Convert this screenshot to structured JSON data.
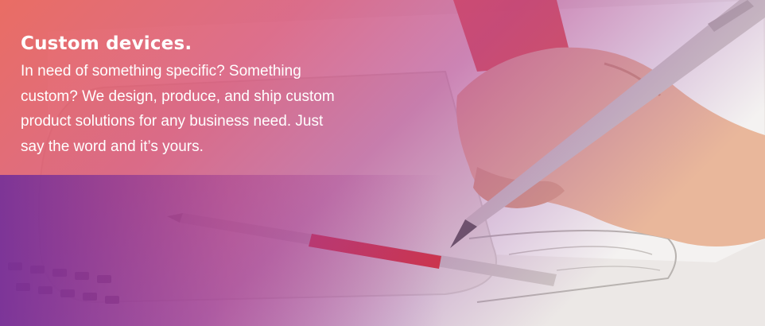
{
  "hero": {
    "heading": "Custom devices.",
    "body": "In need of something specific? Something custom? We design, produce, and ship custom product solutions for any business need. Just say the word and it’s yours."
  },
  "colors": {
    "overlay_start": "#e95c52",
    "overlay_mid": "#b3408f",
    "overlay_end": "#6c2b9b",
    "text": "#ffffff",
    "accent_red": "#e0322e",
    "pen_silver": "#c9c3be"
  },
  "icons": {
    "pen": "stylus-pen-icon",
    "hand": "hand-icon"
  }
}
